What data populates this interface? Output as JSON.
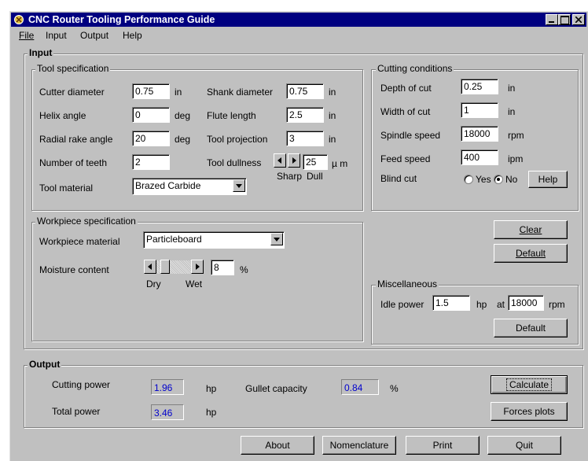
{
  "window": {
    "title": "CNC Router Tooling Performance Guide"
  },
  "menu": [
    "File",
    "Input",
    "Output",
    "Help"
  ],
  "input_group": "Input",
  "tool": {
    "group": "Tool specification",
    "cutter_diameter": {
      "label": "Cutter diameter",
      "value": "0.75",
      "unit": "in"
    },
    "helix_angle": {
      "label": "Helix angle",
      "value": "0",
      "unit": "deg"
    },
    "radial_rake": {
      "label": "Radial rake angle",
      "value": "20",
      "unit": "deg"
    },
    "teeth": {
      "label": "Number of teeth",
      "value": "2"
    },
    "material": {
      "label": "Tool material",
      "value": "Brazed Carbide"
    },
    "shank_diameter": {
      "label": "Shank diameter",
      "value": "0.75",
      "unit": "in"
    },
    "flute_length": {
      "label": "Flute length",
      "value": "2.5",
      "unit": "in"
    },
    "projection": {
      "label": "Tool projection",
      "value": "3",
      "unit": "in"
    },
    "dullness": {
      "label": "Tool dullness",
      "value": "25",
      "unit": "µ m",
      "min_label": "Sharp",
      "max_label": "Dull"
    }
  },
  "cutting": {
    "group": "Cutting conditions",
    "depth": {
      "label": "Depth of cut",
      "value": "0.25",
      "unit": "in"
    },
    "width": {
      "label": "Width of cut",
      "value": "1",
      "unit": "in"
    },
    "spindle": {
      "label": "Spindle speed",
      "value": "18000",
      "unit": "rpm"
    },
    "feed": {
      "label": "Feed speed",
      "value": "400",
      "unit": "ipm"
    },
    "blind_cut": {
      "label": "Blind cut",
      "yes": "Yes",
      "no": "No",
      "selected": "No"
    },
    "help_button": "Help"
  },
  "workpiece": {
    "group": "Workpiece specification",
    "material": {
      "label": "Workpiece material",
      "value": "Particleboard"
    },
    "moisture": {
      "label": "Moisture content",
      "value": "8",
      "unit": "%",
      "min_label": "Dry",
      "max_label": "Wet"
    }
  },
  "buttons": {
    "clear": "Clear",
    "default": "Default"
  },
  "misc": {
    "group": "Miscellaneous",
    "idle_power": {
      "label": "Idle power",
      "value": "1.5",
      "unit": "hp",
      "at": "at",
      "rpm_value": "18000",
      "rpm_unit": "rpm"
    },
    "default": "Default"
  },
  "output": {
    "group": "Output",
    "cutting_power": {
      "label": "Cutting power",
      "value": "1.96",
      "unit": "hp"
    },
    "gullet": {
      "label": "Gullet capacity",
      "value": "0.84",
      "unit": "%"
    },
    "total_power": {
      "label": "Total power",
      "value": "3.46",
      "unit": "hp"
    },
    "calculate": "Calculate",
    "forces": "Forces plots"
  },
  "bottom": [
    "About",
    "Nomenclature",
    "Print",
    "Quit"
  ],
  "colors": {
    "titlebar": "#000080",
    "face": "#c0c0c0",
    "output_value": "#0000cc"
  }
}
